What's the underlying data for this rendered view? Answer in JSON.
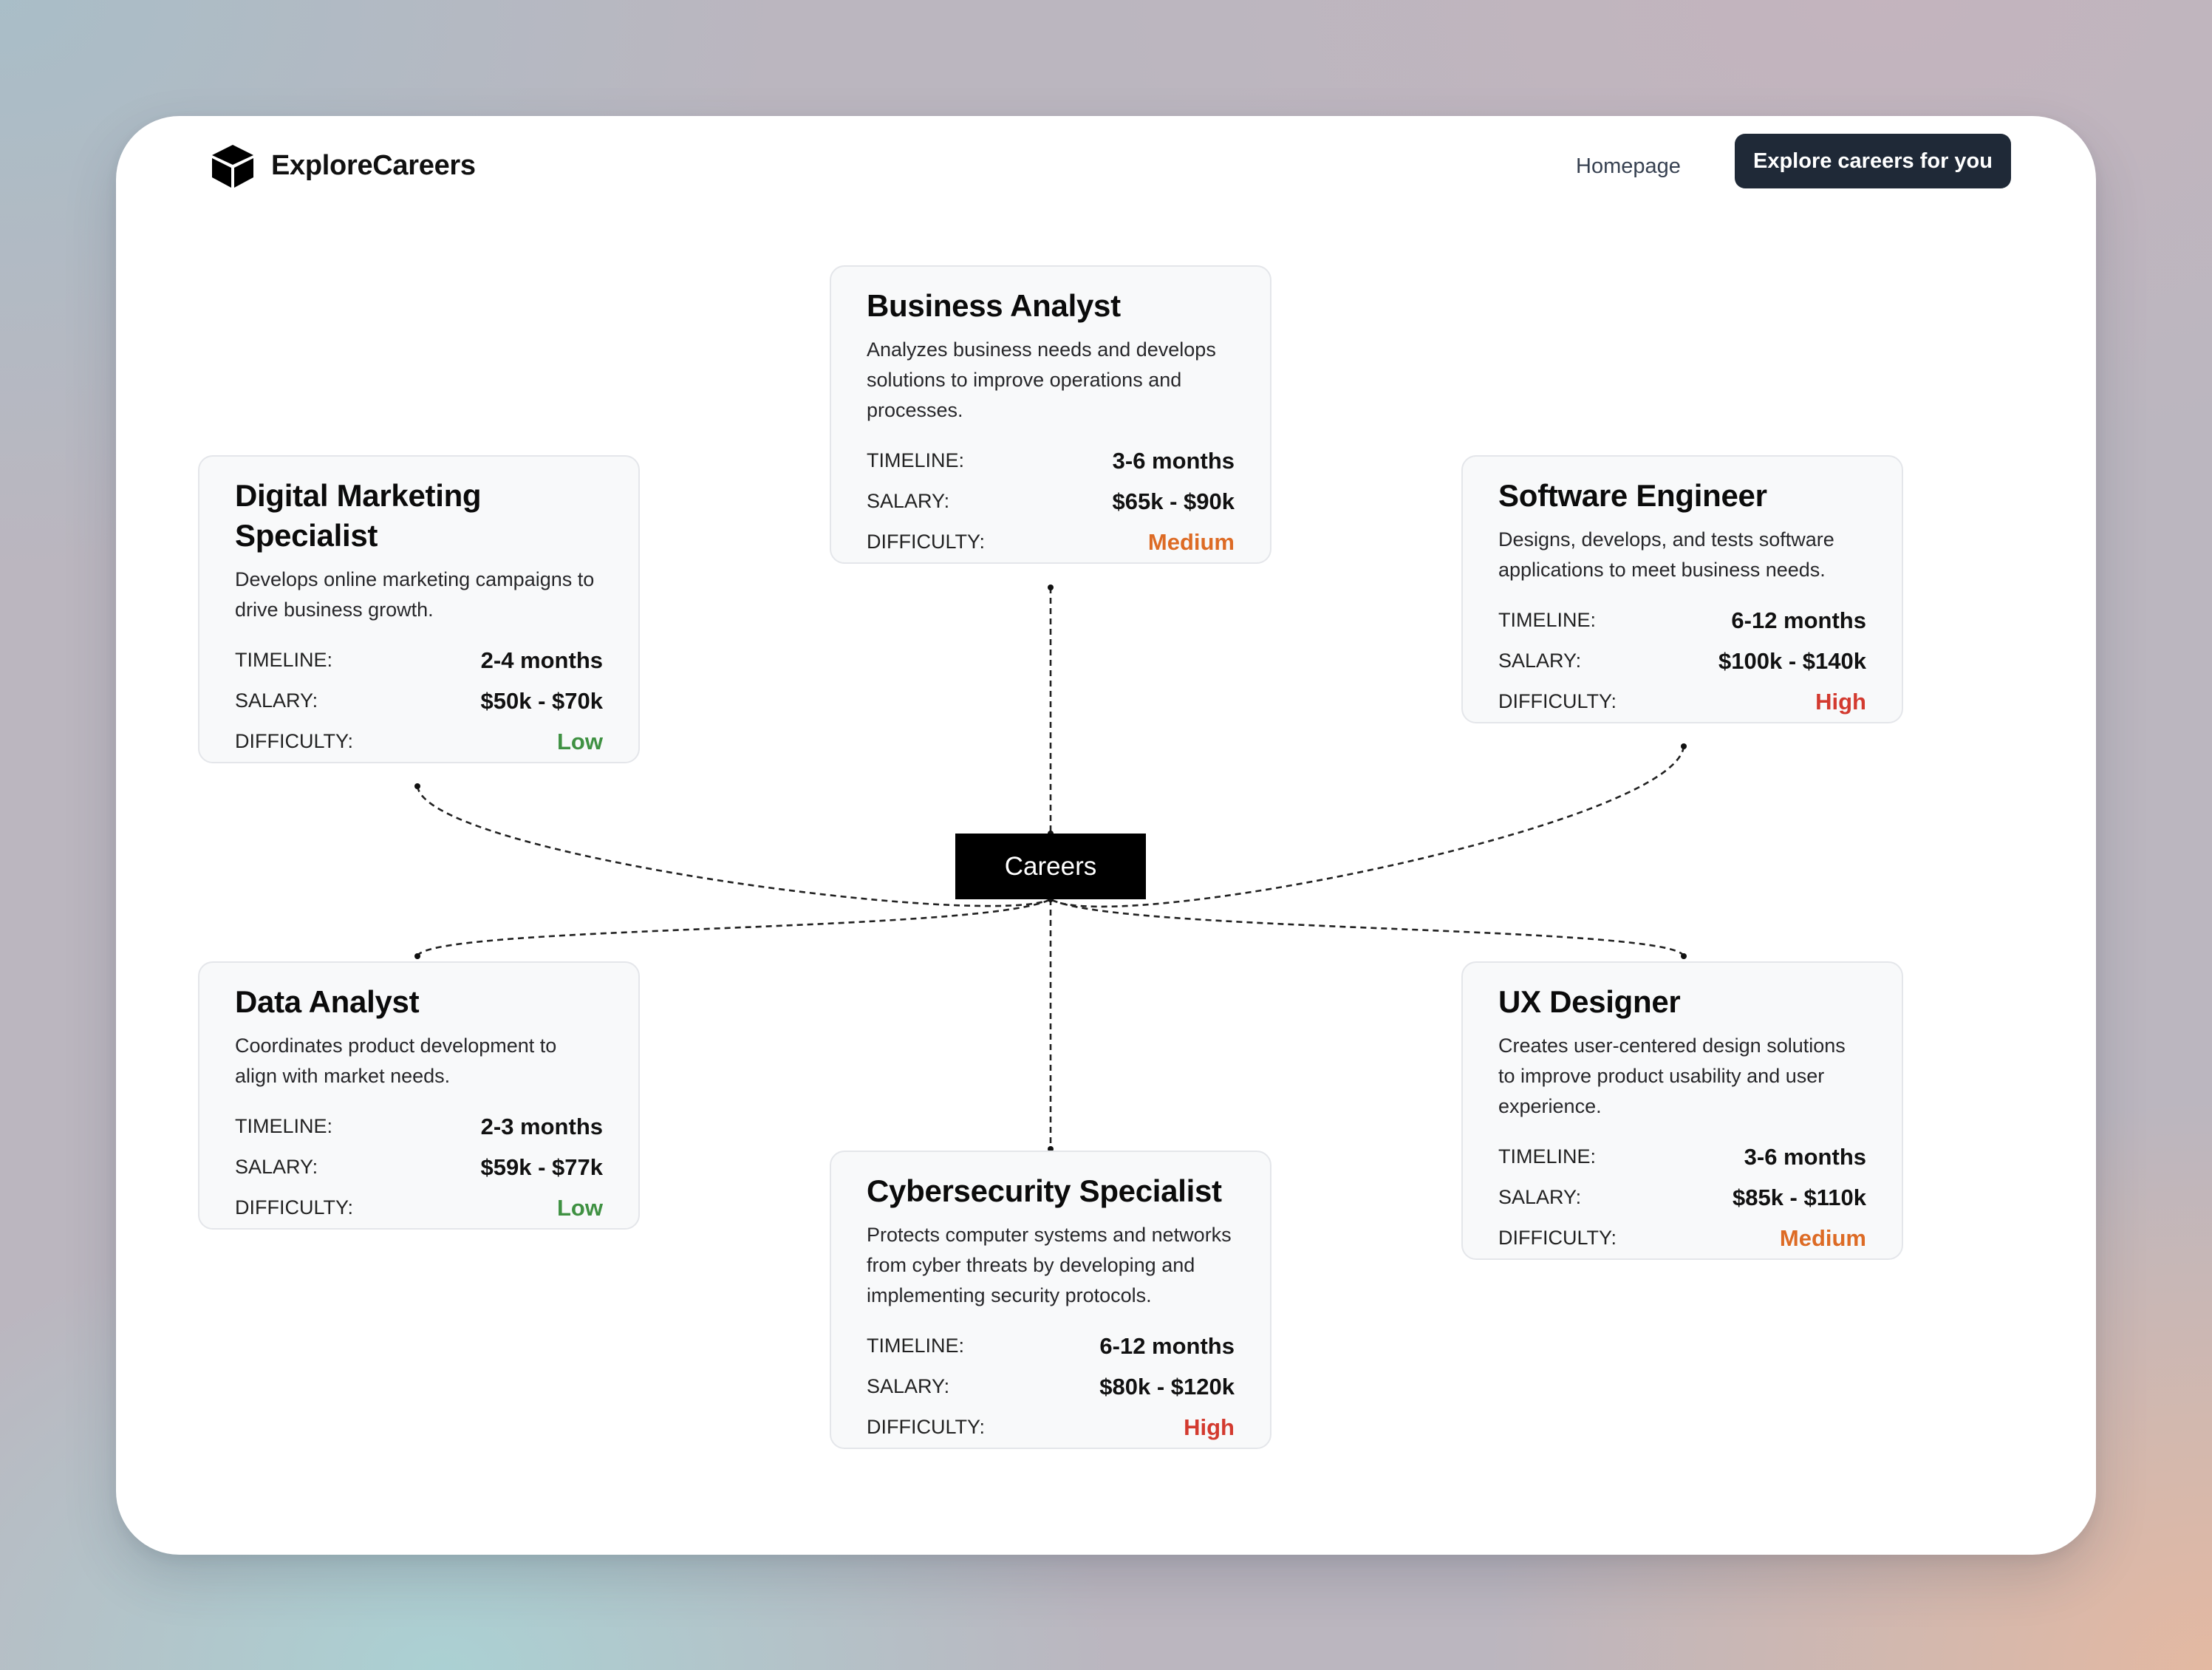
{
  "nav": {
    "brand": "ExploreCareers",
    "homepage_label": "Homepage",
    "cta_label": "Explore careers for you"
  },
  "hub": {
    "label": "Careers"
  },
  "labels": {
    "timeline": "TIMELINE:",
    "salary": "SALARY:",
    "difficulty": "DIFFICULTY:"
  },
  "colors": {
    "low": "#3f9142",
    "medium": "#dd6b25",
    "high": "#d33a2f",
    "cta": "#1f2937"
  },
  "careers": [
    {
      "title": "Business Analyst",
      "description": "Analyzes business needs and develops solutions to improve operations and processes.",
      "timeline": "3-6 months",
      "salary": "$65k - $90k",
      "difficulty": "Medium",
      "level": "medium"
    },
    {
      "title": "Digital Marketing Specialist",
      "description": "Develops online marketing campaigns to drive business growth.",
      "timeline": "2-4 months",
      "salary": "$50k - $70k",
      "difficulty": "Low",
      "level": "low"
    },
    {
      "title": "Software Engineer",
      "description": "Designs, develops, and tests software applications to meet business needs.",
      "timeline": "6-12 months",
      "salary": "$100k - $140k",
      "difficulty": "High",
      "level": "high"
    },
    {
      "title": "Data Analyst",
      "description": "Coordinates product development to align with market needs.",
      "timeline": "2-3 months",
      "salary": "$59k - $77k",
      "difficulty": "Low",
      "level": "low"
    },
    {
      "title": "UX Designer",
      "description": "Creates user-centered design solutions to improve product usability and user experience.",
      "timeline": "3-6 months",
      "salary": "$85k - $110k",
      "difficulty": "Medium",
      "level": "medium"
    },
    {
      "title": "Cybersecurity Specialist",
      "description": "Protects computer systems and networks from cyber threats by developing and implementing security protocols.",
      "timeline": "6-12 months",
      "salary": "$80k - $120k",
      "difficulty": "High",
      "level": "high"
    }
  ]
}
